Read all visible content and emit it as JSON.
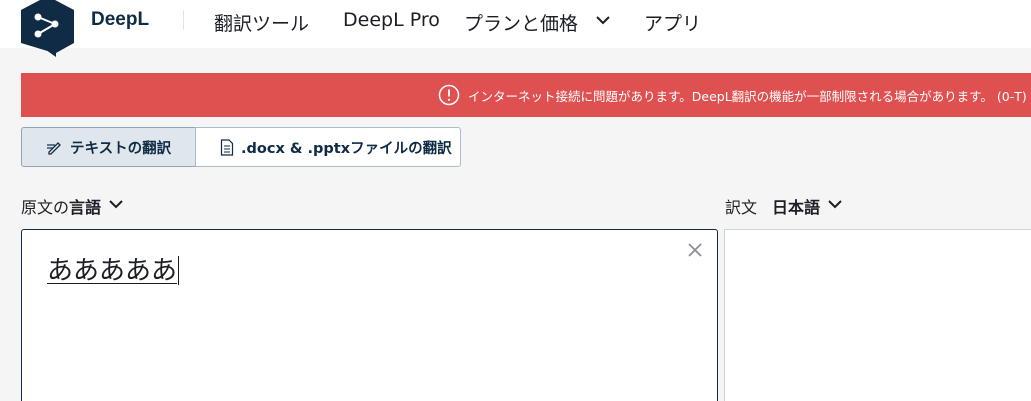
{
  "header": {
    "brand": "DeepL",
    "nav": {
      "translator": "翻訳ツール",
      "pro": "DeepL Pro",
      "plans": "プランと価格",
      "apps": "アプリ"
    }
  },
  "banner": {
    "message": "インターネット接続に問題があります。DeepL翻訳の機能が一部制限される場合があります。 (0-T)"
  },
  "tabs": {
    "text": "テキストの翻訳",
    "document": ".docx & .pptxファイルの翻訳"
  },
  "source": {
    "label_prefix": "原文の",
    "language": "言語",
    "input_value": "あああああ"
  },
  "target": {
    "label": "訳文",
    "language": "日本語"
  },
  "colors": {
    "banner": "#df5151",
    "brand_navy": "#0f2b46",
    "tab_active": "#dfe6ec"
  }
}
